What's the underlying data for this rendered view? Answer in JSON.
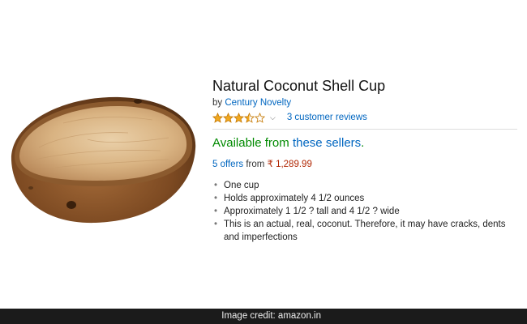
{
  "product": {
    "title": "Natural Coconut Shell Cup",
    "by_prefix": "by",
    "brand": "Century Novelty",
    "rating": 3.5,
    "rating_max": 5,
    "reviews_text": "3 customer reviews",
    "availability_prefix": "Available from",
    "availability_link": "these sellers",
    "availability_suffix": ".",
    "offers_link": "5 offers",
    "offers_from": "from",
    "price": "₹ 1,289.99",
    "features": [
      "One cup",
      "Holds approximately 4 1/2 ounces",
      "Approximately 1 1/2 ? tall and 4 1/2 ? wide",
      "This is an actual, real, coconut. Therefore, it may have cracks, dents and imperfections"
    ]
  },
  "icons": {
    "star_full": "star-full-icon",
    "star_half": "star-half-icon",
    "star_empty": "star-empty-icon",
    "caret": "chevron-down-icon"
  },
  "colors": {
    "star_fill": "#f0a81f",
    "star_stroke": "#c77d0a",
    "link": "#0066c0",
    "availability": "#008a00",
    "price": "#b12704",
    "caption_bar": "#1b1b1b"
  },
  "caption": "Image credit: amazon.in"
}
